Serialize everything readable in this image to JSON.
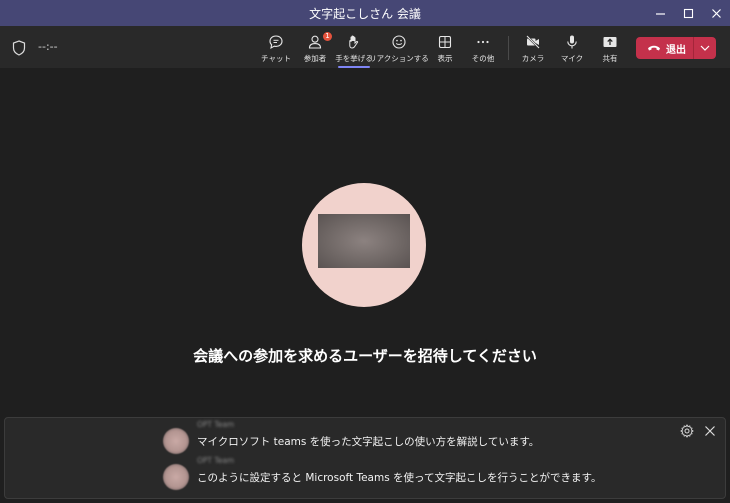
{
  "window": {
    "title": "文字起こしさん 会議"
  },
  "toolbar": {
    "timer": "--:--",
    "chat": "チャット",
    "participants": "参加者",
    "participants_badge": "1",
    "raise_hand": "手を挙げる",
    "reactions": "リアクションする",
    "view": "表示",
    "more": "その他",
    "camera": "カメラ",
    "mic": "マイク",
    "share": "共有",
    "leave": "退出"
  },
  "stage": {
    "invite_text": "会議への参加を求めるユーザーを招待してください"
  },
  "captions": {
    "items": [
      {
        "speaker": "OPT Team",
        "text": "マイクロソフト teams を使った文字起こしの使い方を解説しています。"
      },
      {
        "speaker": "OPT Team",
        "text": "このように設定すると Microsoft Teams を使って文字起こしを行うことができます。"
      }
    ]
  },
  "colors": {
    "title_bar": "#464775",
    "leave": "#c4314b",
    "accent": "#7f85f5",
    "avatar_bg": "#f1d2cc"
  }
}
